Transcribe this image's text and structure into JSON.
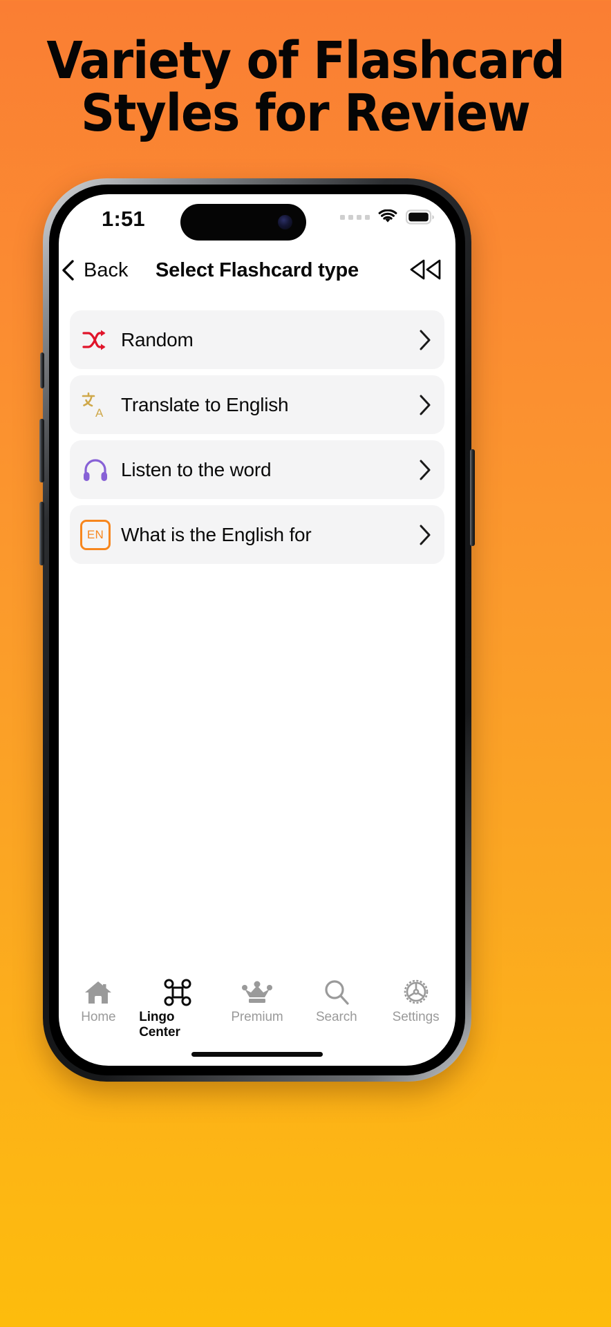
{
  "promo": {
    "headline_line1": "Variety of Flashcard",
    "headline_line2": "Styles for Review",
    "background_start": "#fa7e33",
    "background_end": "#fdbc0c"
  },
  "status_bar": {
    "time": "1:51",
    "signal_icon": "signal-dots-icon",
    "wifi_icon": "wifi-icon",
    "battery_icon": "battery-full-icon"
  },
  "nav_bar": {
    "back_label": "Back",
    "back_icon": "chevron-left-icon",
    "title": "Select Flashcard type",
    "action_icon": "rewind-icon"
  },
  "flashcard_types": [
    {
      "label": "Random",
      "icon": "shuffle-icon",
      "icon_color": "#e0142a",
      "chevron": "chevron-right-icon"
    },
    {
      "label": "Translate to English",
      "icon": "translate-icon",
      "icon_color": "#cfa84a",
      "chevron": "chevron-right-icon"
    },
    {
      "label": "Listen to the word",
      "icon": "headphones-icon",
      "icon_color": "#8761d6",
      "chevron": "chevron-right-icon"
    },
    {
      "label": "What is the English for",
      "icon": "en-badge-icon",
      "icon_color": "#f7861d",
      "badge_text": "EN",
      "chevron": "chevron-right-icon"
    }
  ],
  "tab_bar": {
    "items": [
      {
        "label": "Home",
        "icon": "home-icon",
        "active": false
      },
      {
        "label": "Lingo Center",
        "icon": "command-icon",
        "active": true
      },
      {
        "label": "Premium",
        "icon": "crown-icon",
        "active": false
      },
      {
        "label": "Search",
        "icon": "search-icon",
        "active": false
      },
      {
        "label": "Settings",
        "icon": "gear-icon",
        "active": false
      }
    ],
    "inactive_color": "#9a9a9a",
    "active_color": "#0a0a0a"
  }
}
